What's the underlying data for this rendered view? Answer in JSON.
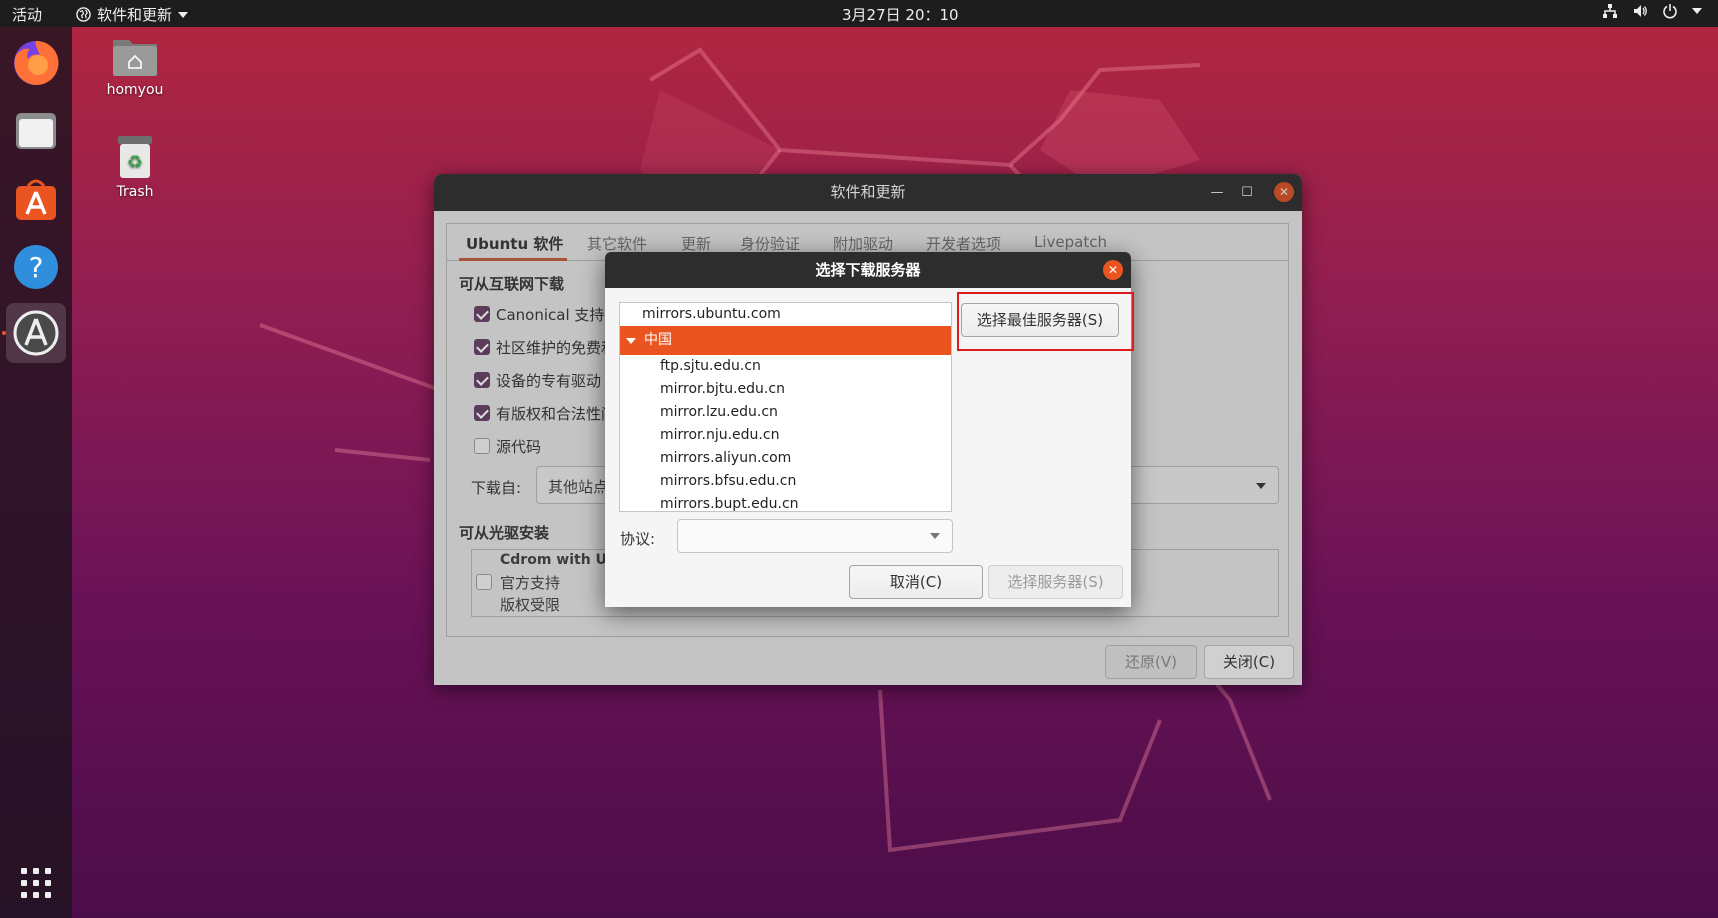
{
  "topbar": {
    "activities": "活动",
    "app_menu": "软件和更新",
    "clock": "3月27日  20：10"
  },
  "desktop": {
    "icons": [
      {
        "label": "homyou"
      },
      {
        "label": "Trash"
      }
    ]
  },
  "main_window": {
    "title": "软件和更新",
    "tabs": [
      "Ubuntu 软件",
      "其它软件",
      "更新",
      "身份验证",
      "附加驱动",
      "开发者选项",
      "Livepatch"
    ],
    "internet_section": "可从互联网下载",
    "checkboxes": [
      {
        "label": "Canonical 支持的",
        "checked": true
      },
      {
        "label": "社区维护的免费和",
        "checked": true
      },
      {
        "label": "设备的专有驱动 (",
        "checked": true
      },
      {
        "label": "有版权和合法性问",
        "checked": true
      },
      {
        "label": "源代码",
        "checked": false
      }
    ],
    "download_from_label": "下载自:",
    "download_from_value": "其他站点",
    "cdrom_section": "可从光驱安装",
    "cdrom": {
      "title": "Cdrom with Ubu",
      "line1": "官方支持",
      "line2": "版权受限"
    },
    "revert_button": "还原(V)",
    "close_button": "关闭(C)"
  },
  "dialog": {
    "title": "选择下载服务器",
    "mirrors": {
      "top": "mirrors.ubuntu.com",
      "selected_group": "中国",
      "children": [
        "ftp.sjtu.edu.cn",
        "mirror.bjtu.edu.cn",
        "mirror.lzu.edu.cn",
        "mirror.nju.edu.cn",
        "mirrors.aliyun.com",
        "mirrors.bfsu.edu.cn",
        "mirrors.bupt.edu.cn"
      ]
    },
    "best_server_button": "选择最佳服务器(S)",
    "protocol_label": "协议:",
    "protocol_value": "",
    "cancel_button": "取消(C)",
    "choose_server_button": "选择服务器(S)"
  },
  "colors": {
    "accent": "#e95420",
    "highlight": "#e01b1b",
    "titlebar": "#2d2d2d"
  }
}
